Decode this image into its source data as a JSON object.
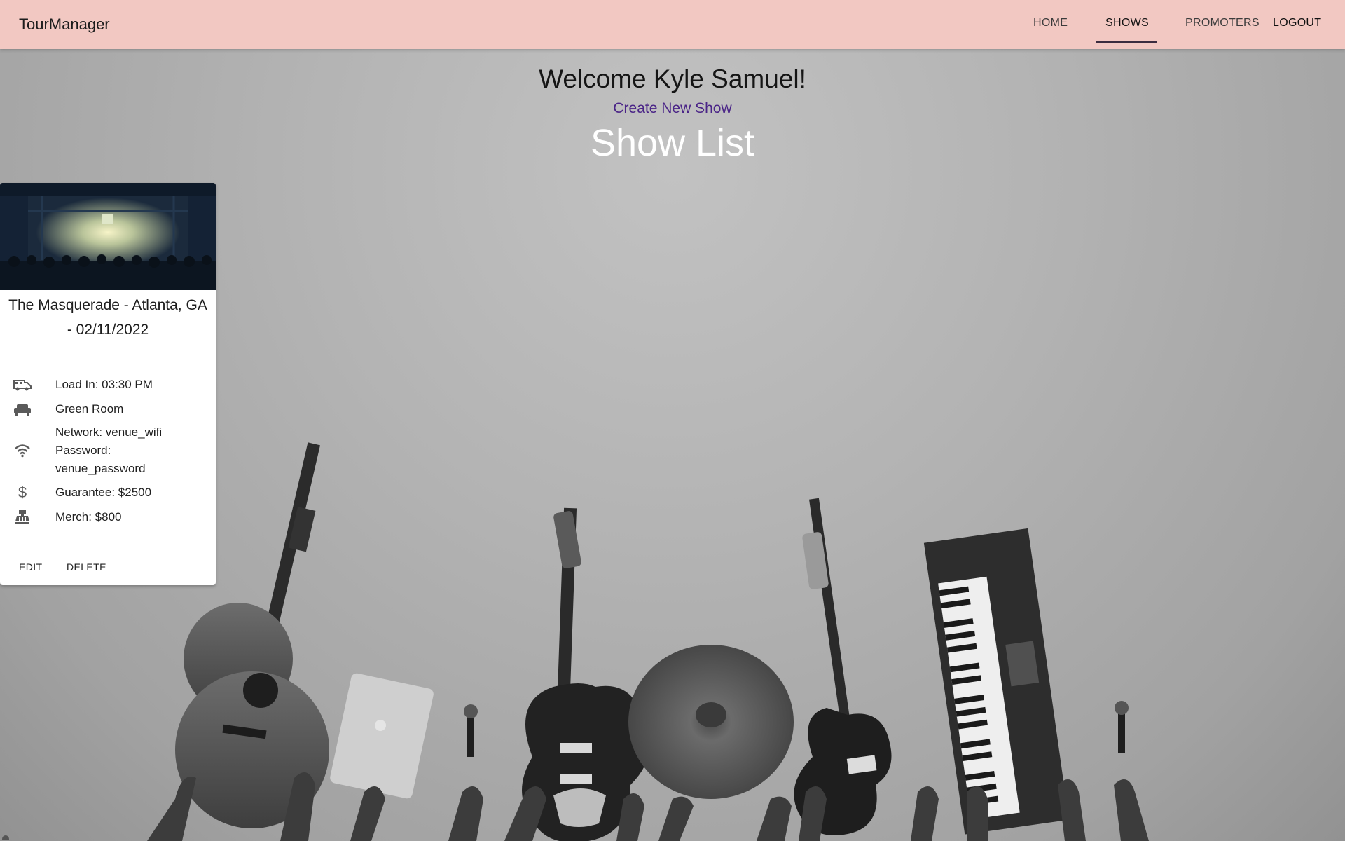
{
  "app": {
    "brand": "TourManager"
  },
  "nav": {
    "home": "HOME",
    "shows": "SHOWS",
    "promoters": "PROMOTERS",
    "logout": "LOGOUT",
    "active": "SHOWS",
    "active_underline_color": "#3b2c3f"
  },
  "header": {
    "welcome": "Welcome Kyle Samuel!",
    "create_link": "Create New Show",
    "title": "Show List"
  },
  "shows": [
    {
      "title_line1": "The Masquerade - Atlanta, GA",
      "title_line2": "- 02/11/2022",
      "load_in": "Load In: 03:30 PM",
      "green_room": "Green Room",
      "network": "Network: venue_wifi",
      "password_label": "Password:",
      "password": "venue_password",
      "guarantee": "Guarantee: $2500",
      "merch": "Merch: $800",
      "edit_label": "EDIT",
      "delete_label": "DELETE"
    }
  ],
  "colors": {
    "appbar": "#f2c8c2",
    "link": "#4a2487",
    "title": "#ffffff",
    "card": "#ffffff"
  },
  "icons": [
    "van-icon",
    "sofa-icon",
    "wifi-icon",
    "dollar-icon",
    "cash-register-icon"
  ]
}
